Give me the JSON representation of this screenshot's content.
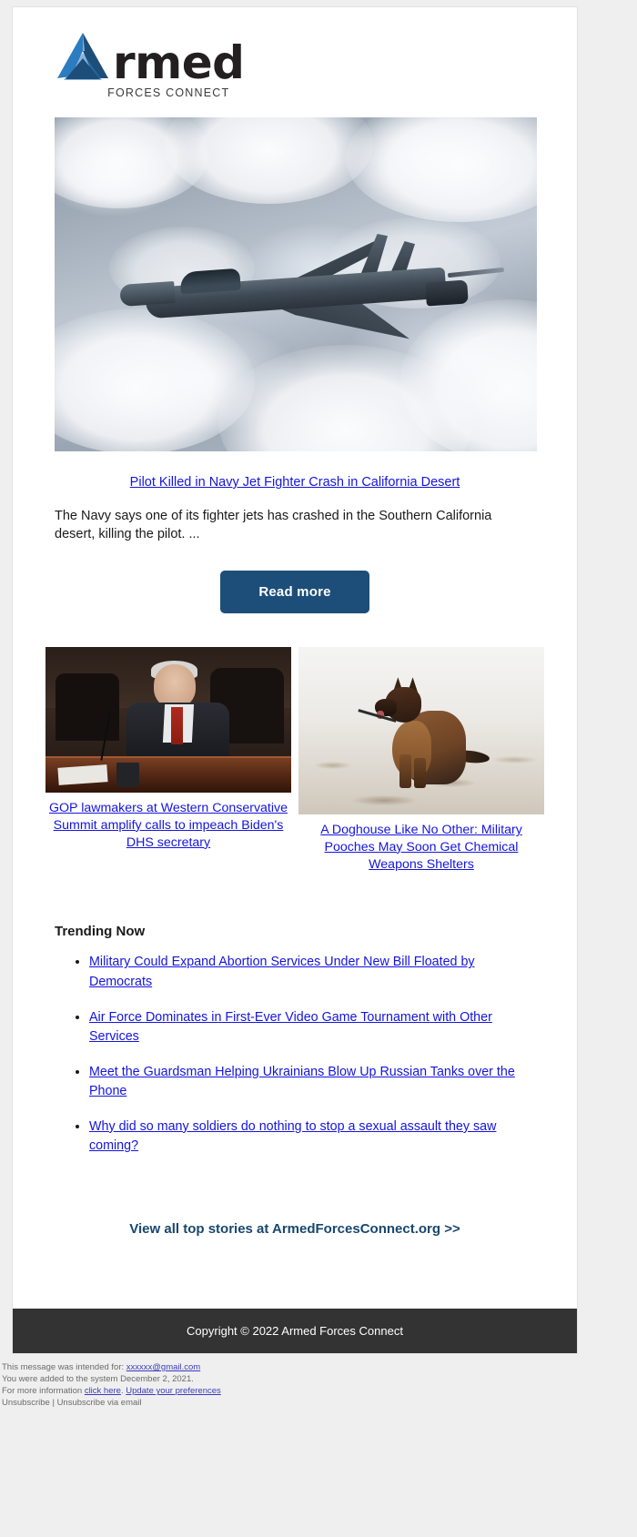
{
  "brand": {
    "logo_word": "rmed",
    "logo_subtitle": "FORCES CONNECT",
    "logo_icon": "triangle-a-logo",
    "accent_dark_blue": "#1d4e79",
    "accent_mid_blue": "#2b7cc0",
    "link_blue": "#1414e0"
  },
  "hero": {
    "image_name": "navy-jet-fighter-in-clouds",
    "headline": "Pilot Killed in Navy Jet Fighter Crash in California Desert",
    "summary": "The Navy says one of its fighter jets has crashed in the Southern California desert, killing the pilot. ...",
    "button_label": "Read more"
  },
  "stories": [
    {
      "image_name": "congressional-hearing-photo",
      "caption": "GOP lawmakers at Western Conservative Summit amplify calls to impeach Biden's DHS secretary"
    },
    {
      "image_name": "military-dog-in-snow-photo",
      "caption": "A Doghouse Like No Other: Military Pooches May Soon Get Chemical Weapons Shelters"
    }
  ],
  "trending": {
    "title": "Trending Now",
    "items": [
      "Military Could Expand Abortion Services Under New Bill Floated by Democrats",
      "Air Force Dominates in First-Ever Video Game Tournament with Other Services",
      "Meet the Guardsman Helping Ukrainians Blow Up Russian Tanks over the Phone",
      "Why did so many soldiers do nothing to stop a sexual assault they saw coming?"
    ]
  },
  "view_all": {
    "label": "View all top stories at ArmedForcesConnect.org >>"
  },
  "footer": {
    "copyright": "Copyright © 2022 Armed Forces Connect"
  },
  "disclaimer": {
    "line1_prefix": "This message was intended for: ",
    "line1_email": "xxxxxx@gmail.com",
    "line2": "You were added to the system December 2, 2021.",
    "line3_prefix": "For more information ",
    "line3_link1": "click here",
    "line3_mid": ". ",
    "line3_link2": "Update your preferences",
    "line4_link": "Unsubscribe",
    "line4_sep": " | ",
    "line4_rest": "Unsubscribe via email"
  }
}
